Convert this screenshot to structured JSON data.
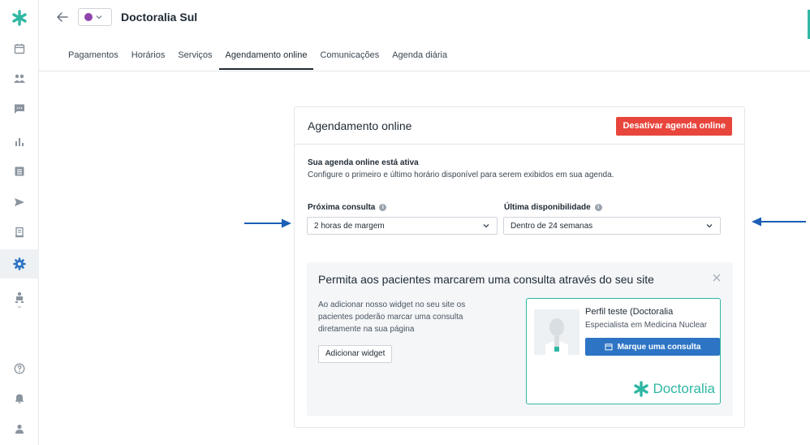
{
  "header": {
    "clinic_name": "Doctoralia Sul",
    "color": "#8e44ad"
  },
  "tabs": [
    {
      "label": "Pagamentos"
    },
    {
      "label": "Horários"
    },
    {
      "label": "Serviços"
    },
    {
      "label": "Agendamento online",
      "active": true
    },
    {
      "label": "Comunicações"
    },
    {
      "label": "Agenda diária"
    }
  ],
  "card": {
    "title": "Agendamento online",
    "deactivate_label": "Desativar agenda online",
    "status_title": "Sua agenda online está ativa",
    "status_desc": "Configure o primeiro e último horário disponível para serem exibidos em sua agenda.",
    "next_label": "Próxima consulta",
    "next_value": "2 horas de margem",
    "last_label": "Última disponibilidade",
    "last_value": "Dentro de 24 semanas"
  },
  "promo": {
    "title": "Permita aos pacientes marcarem uma consulta através do seu site",
    "text": "Ao adicionar nosso widget no seu site os pacientes poderão marcar uma consulta diretamente na sua página",
    "button_label": "Adicionar widget",
    "preview": {
      "name": "Perfil teste (Doctoralia",
      "specialty": "Especialista em Medicina Nuclear",
      "book_label": "Marque uma consulta",
      "brand": "Doctoralia"
    }
  },
  "colors": {
    "accent": "#2fb7a3",
    "danger": "#e8453c",
    "primary": "#2d74c4",
    "arrow": "#1b5fb5"
  }
}
